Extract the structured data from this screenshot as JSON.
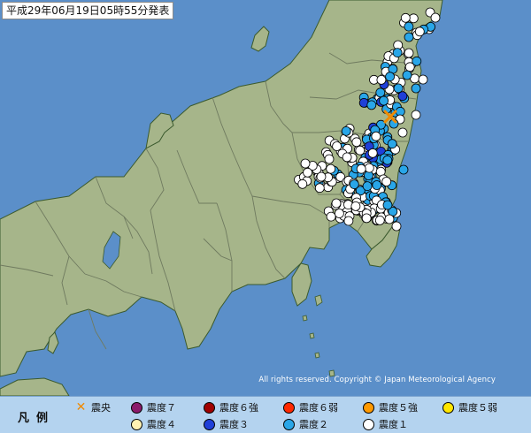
{
  "map": {
    "title": "平成29年06月19日05時55分発表",
    "copyright": "All rights reserved. Copyright © Japan Meteorological Agency",
    "colors": {
      "sea": "#5b8fc9",
      "land": "#a6b58a",
      "boundary": "#6f7a5f",
      "coast": "#3b5a2e"
    }
  },
  "legend": {
    "title": "凡例",
    "items": [
      {
        "label": "震央",
        "kind": "cross",
        "color": "#f08a00"
      },
      {
        "label": "震度７",
        "kind": "dot",
        "color": "#8b1a6b"
      },
      {
        "label": "震度６強",
        "kind": "dot",
        "color": "#a00000"
      },
      {
        "label": "震度６弱",
        "kind": "dot",
        "color": "#ff2800"
      },
      {
        "label": "震度５強",
        "kind": "dot",
        "color": "#ff9900"
      },
      {
        "label": "震度５弱",
        "kind": "dot",
        "color": "#ffe600"
      },
      {
        "label": "震度４",
        "kind": "dot",
        "color": "#fff2b3"
      },
      {
        "label": "震度３",
        "kind": "dot",
        "color": "#1f3fd8"
      },
      {
        "label": "震度２",
        "kind": "dot",
        "color": "#29a6e8"
      },
      {
        "label": "震度１",
        "kind": "dot",
        "color": "#ffffff"
      }
    ]
  }
}
